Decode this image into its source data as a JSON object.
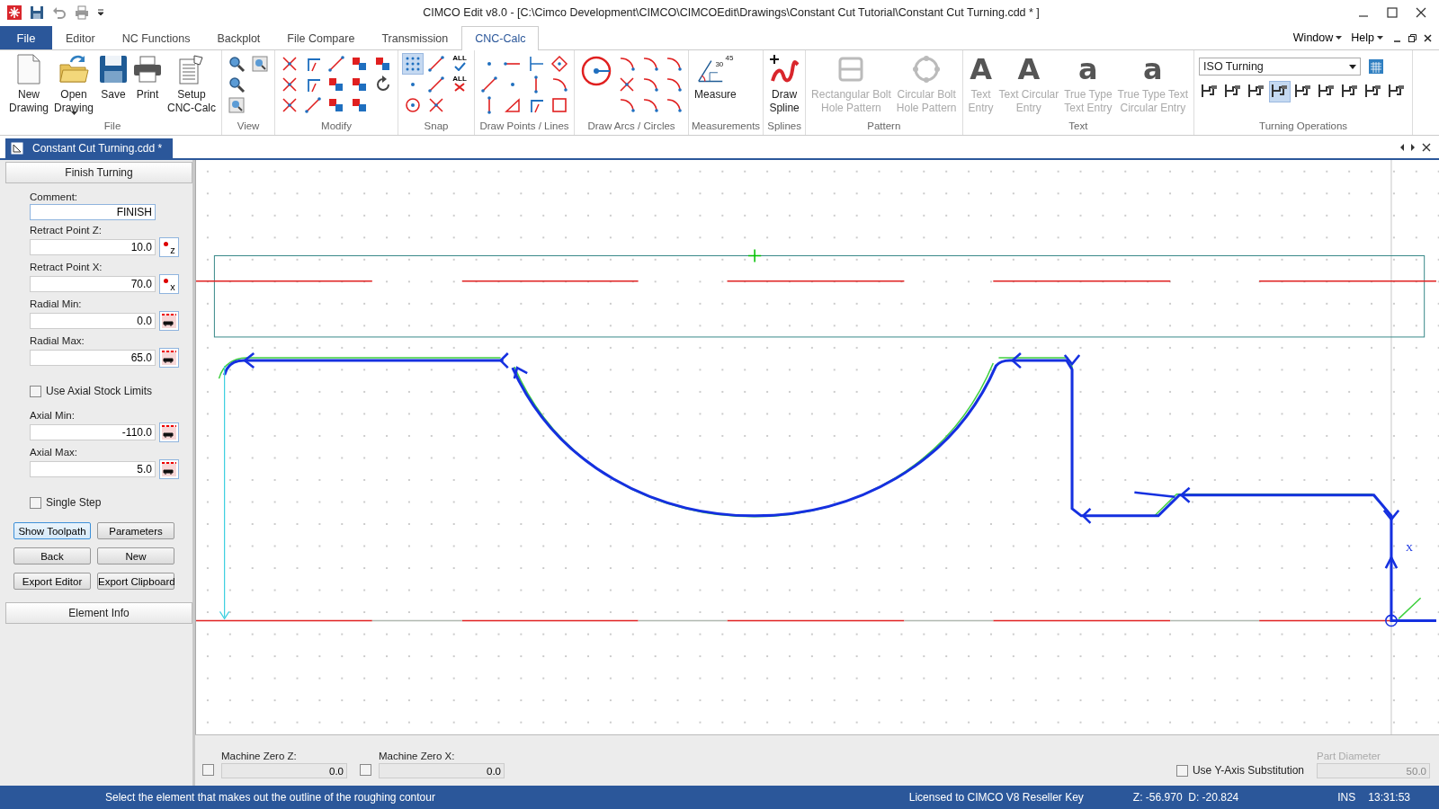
{
  "window": {
    "title": "CIMCO Edit v8.0 - [C:\\Cimco Development\\CIMCO\\CIMCOEdit\\Drawings\\Constant Cut Tutorial\\Constant Cut Turning.cdd * ]"
  },
  "menu": {
    "file": "File",
    "tabs": [
      {
        "label": "Editor",
        "selected": false
      },
      {
        "label": "NC Functions",
        "selected": false
      },
      {
        "label": "Backplot",
        "selected": false
      },
      {
        "label": "File Compare",
        "selected": false
      },
      {
        "label": "Transmission",
        "selected": false
      },
      {
        "label": "CNC-Calc",
        "selected": true
      }
    ],
    "right": [
      "Window",
      "Help"
    ]
  },
  "ribbon": {
    "groups": [
      {
        "label": "File",
        "kind": "big",
        "items": [
          {
            "kind": "new",
            "lines": [
              "New",
              "Drawing"
            ],
            "dropdown": false,
            "disabled": false
          },
          {
            "kind": "open",
            "lines": [
              "Open",
              "Drawing"
            ],
            "dropdown": true,
            "disabled": false
          },
          {
            "kind": "save",
            "lines": [
              "Save"
            ],
            "dropdown": false,
            "disabled": false
          },
          {
            "kind": "print",
            "lines": [
              "Print"
            ],
            "dropdown": false,
            "disabled": false
          },
          {
            "kind": "setup",
            "lines": [
              "Setup",
              "CNC-Calc"
            ],
            "dropdown": false,
            "disabled": false
          }
        ]
      },
      {
        "label": "View",
        "kind": "view"
      },
      {
        "label": "Modify",
        "kind": "modify"
      },
      {
        "label": "Snap",
        "kind": "snap",
        "grid_on": true,
        "all_labels": [
          "ALL",
          "ALL"
        ]
      },
      {
        "label": "Draw Points / Lines",
        "kind": "points"
      },
      {
        "label": "Draw Arcs / Circles",
        "kind": "arcs"
      },
      {
        "label": "Measurements",
        "kind": "big",
        "items": [
          {
            "kind": "measure",
            "lines": [
              "Measure"
            ],
            "dropdown": false,
            "disabled": false,
            "icon_text": [
              "45",
              "30"
            ]
          }
        ]
      },
      {
        "label": "Splines",
        "kind": "big",
        "items": [
          {
            "kind": "spline",
            "lines": [
              "Draw",
              "Spline"
            ],
            "dropdown": false,
            "disabled": false
          }
        ]
      },
      {
        "label": "Pattern",
        "kind": "big",
        "items": [
          {
            "kind": "rect_pattern",
            "lines": [
              "Rectangular Bolt",
              "Hole Pattern"
            ],
            "dropdown": false,
            "disabled": true
          },
          {
            "kind": "circle_pattern",
            "lines": [
              "Circular Bolt",
              "Hole Pattern"
            ],
            "dropdown": false,
            "disabled": true
          }
        ]
      },
      {
        "label": "Text",
        "kind": "big",
        "items": [
          {
            "kind": "glyph",
            "glyph": "A",
            "lines": [
              "Text",
              "Entry"
            ],
            "dropdown": false,
            "disabled": true
          },
          {
            "kind": "glyph",
            "glyph": "A",
            "lines": [
              "Text Circular",
              "Entry"
            ],
            "dropdown": false,
            "disabled": true
          },
          {
            "kind": "glyph",
            "glyph": "a",
            "lines": [
              "True Type",
              "Text Entry"
            ],
            "dropdown": false,
            "disabled": true
          },
          {
            "kind": "glyph",
            "glyph": "a",
            "lines": [
              "True Type Text",
              "Circular Entry"
            ],
            "dropdown": false,
            "disabled": true
          }
        ]
      },
      {
        "label": "Turning Operations",
        "kind": "turning",
        "dropdown": "ISO Turning",
        "buttons": [
          {
            "selected": false
          },
          {
            "selected": false
          },
          {
            "selected": false
          },
          {
            "selected": true
          },
          {
            "selected": false
          },
          {
            "selected": false
          },
          {
            "selected": false
          },
          {
            "selected": false
          },
          {
            "selected": false
          }
        ]
      }
    ]
  },
  "document_tab": {
    "title": "Constant Cut Turning.cdd *"
  },
  "panel": {
    "title": "Finish Turning",
    "fields": [
      {
        "kind": "text",
        "label": "Comment:",
        "value": "FINISH"
      },
      {
        "kind": "point",
        "label": "Retract Point Z:",
        "value": "10.0",
        "axis": "z"
      },
      {
        "kind": "point",
        "label": "Retract Point X:",
        "value": "70.0",
        "axis": "x"
      },
      {
        "kind": "limit",
        "label": "Radial Min:",
        "value": "0.0"
      },
      {
        "kind": "limit",
        "label": "Radial Max:",
        "value": "65.0"
      },
      {
        "kind": "checkbox",
        "label": "Use Axial Stock Limits",
        "checked": false
      },
      {
        "kind": "limit",
        "label": "Axial Min:",
        "value": "-110.0"
      },
      {
        "kind": "limit",
        "label": "Axial Max:",
        "value": "5.0"
      },
      {
        "kind": "checkbox",
        "label": "Single Step",
        "checked": false
      }
    ],
    "buttons": [
      {
        "label": "Show Toolpath",
        "focused": true
      },
      {
        "label": "Parameters",
        "focused": false
      },
      {
        "label": "Back",
        "focused": false
      },
      {
        "label": "New",
        "focused": false
      },
      {
        "label": "Export Editor",
        "focused": false
      },
      {
        "label": "Export Clipboard",
        "focused": false
      }
    ],
    "footer": "Element Info"
  },
  "canvas": {
    "axis_label": "X"
  },
  "bottom_bar": {
    "machine_zero": [
      {
        "label": "Machine Zero Z:",
        "value": "0.0",
        "checked": false
      },
      {
        "label": "Machine Zero X:",
        "value": "0.0",
        "checked": false
      }
    ],
    "y_axis_substitution": {
      "label": "Use Y-Axis Substitution",
      "checked": false
    },
    "part_diameter": {
      "label": "Part Diameter",
      "value": "50.0",
      "disabled": true
    }
  },
  "status_bar": {
    "message": "Select the element that makes out the outline of the roughing contour",
    "license": "Licensed to CIMCO V8 Reseller Key",
    "coordinates": "Z: -56.970  D: -20.824",
    "mode": "INS",
    "time": "13:31:53"
  }
}
